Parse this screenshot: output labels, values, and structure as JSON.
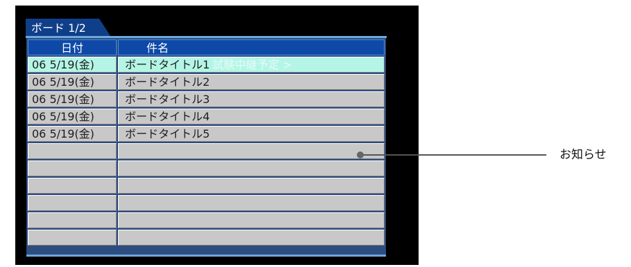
{
  "board": {
    "tab_label": "ボード 1/2",
    "columns": {
      "date": "日付",
      "subject": "件名"
    },
    "rows": [
      {
        "date": "06  5/19(金)",
        "subject": "ボードタイトル1",
        "ghost_text": "試験中継予定 >"
      },
      {
        "date": "06  5/19(金)",
        "subject": "ボードタイトル2"
      },
      {
        "date": "06  5/19(金)",
        "subject": "ボードタイトル3"
      },
      {
        "date": "06  5/19(金)",
        "subject": "ボードタイトル4"
      },
      {
        "date": "06  5/19(金)",
        "subject": "ボードタイトル5"
      },
      {
        "date": "",
        "subject": ""
      },
      {
        "date": "",
        "subject": ""
      },
      {
        "date": "",
        "subject": ""
      },
      {
        "date": "",
        "subject": ""
      },
      {
        "date": "",
        "subject": ""
      },
      {
        "date": "",
        "subject": ""
      }
    ],
    "selected_row": 1
  },
  "callout": {
    "label": "お知らせ"
  },
  "colors": {
    "header_blue": "#0e49a8",
    "selected_row": "#b4f5e6",
    "row_gray": "#c8c8c8",
    "screen_bg": "#000000"
  }
}
